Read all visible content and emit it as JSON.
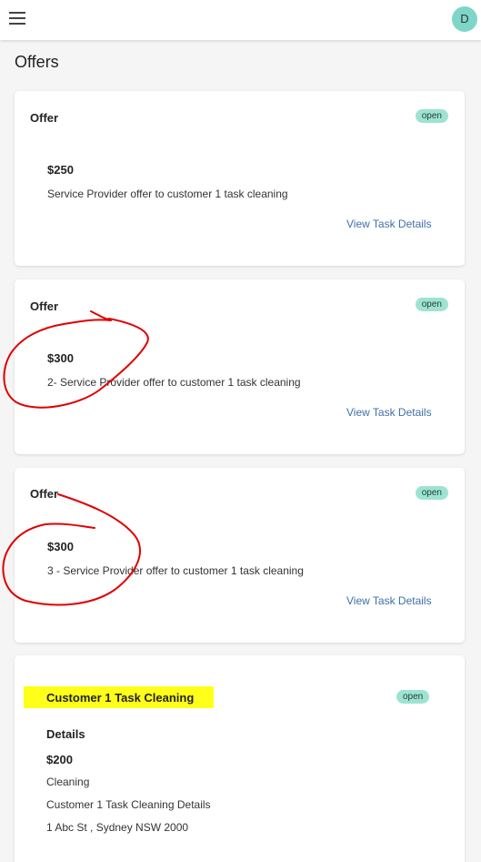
{
  "header": {
    "avatar_initial": "D",
    "menu_icon": "hamburger-menu-icon"
  },
  "page": {
    "title": "Offers"
  },
  "offers": [
    {
      "title": "Offer",
      "status": "open",
      "amount": "$250",
      "description": "Service Provider offer to customer 1 task cleaning",
      "link": "View Task Details"
    },
    {
      "title": "Offer",
      "status": "open",
      "amount": "$300",
      "description": "2- Service Provider offer to customer 1 task cleaning",
      "link": "View Task Details"
    },
    {
      "title": "Offer",
      "status": "open",
      "amount": "$300",
      "description": "3 - Service Provider offer to customer 1 task cleaning",
      "link": "View Task Details"
    }
  ],
  "task": {
    "title": "Customer 1 Task Cleaning",
    "status": "open",
    "details_heading": "Details",
    "price": "$200",
    "category": "Cleaning",
    "details": "Customer 1 Task Cleaning Details",
    "address": "1 Abc St , Sydney NSW 2000"
  },
  "colors": {
    "badge_bg": "#9ee3d1",
    "avatar_bg": "#7ed6c9",
    "link": "#3f6fa8",
    "highlight": "#ffff1a",
    "annotation": "#e00000"
  }
}
